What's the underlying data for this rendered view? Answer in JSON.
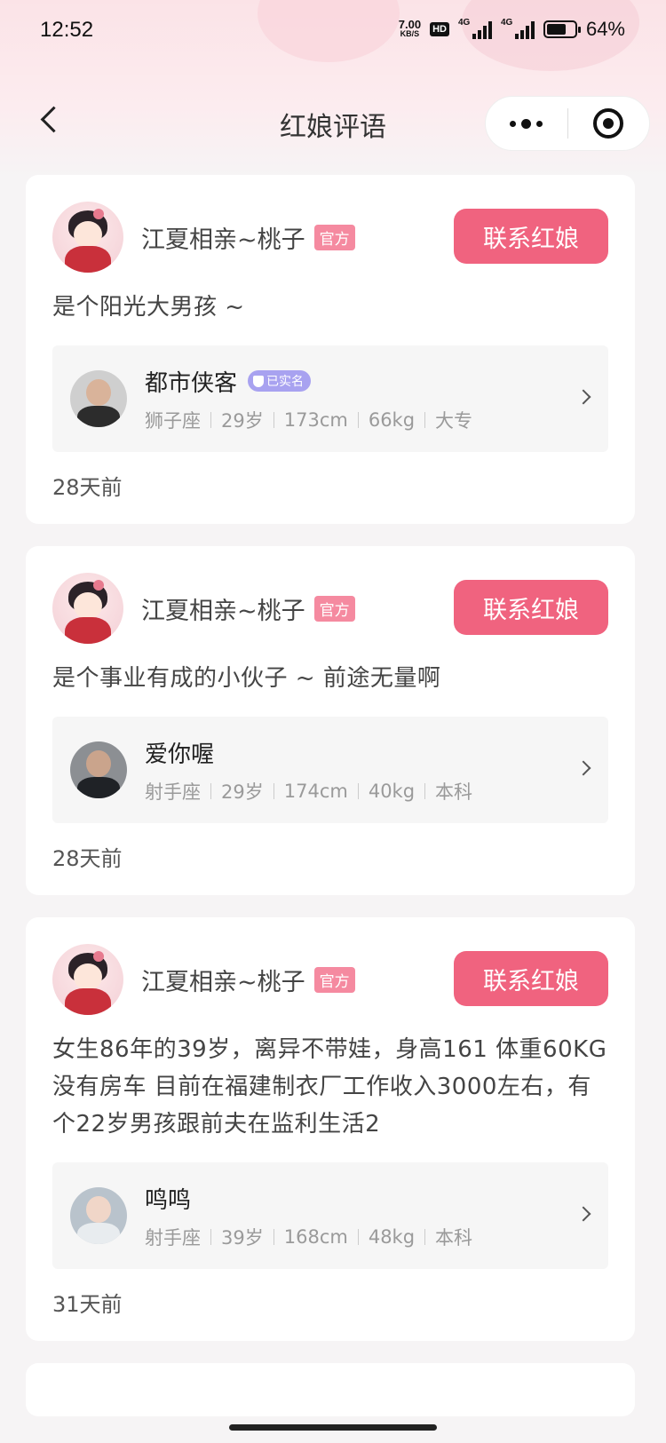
{
  "status_bar": {
    "time": "12:52",
    "speed_value": "7.00",
    "speed_unit": "KB/S",
    "hd": "HD",
    "signal1": "4G",
    "signal2": "4G",
    "battery": "64%"
  },
  "nav": {
    "title": "红娘评语"
  },
  "cards": [
    {
      "matchmaker_name": "江夏相亲~桃子",
      "matchmaker_tag": "官方",
      "contact_label": "联系红娘",
      "comment": "是个阳光大男孩 ~",
      "user": {
        "name": "都市侠客",
        "verified": "已实名",
        "zodiac": "狮子座",
        "age": "29岁",
        "height": "173cm",
        "weight": "66kg",
        "education": "大专"
      },
      "time_ago": "28天前"
    },
    {
      "matchmaker_name": "江夏相亲~桃子",
      "matchmaker_tag": "官方",
      "contact_label": "联系红娘",
      "comment": "是个事业有成的小伙子 ~ 前途无量啊",
      "user": {
        "name": "爱你喔",
        "verified": "",
        "zodiac": "射手座",
        "age": "29岁",
        "height": "174cm",
        "weight": "40kg",
        "education": "本科"
      },
      "time_ago": "28天前"
    },
    {
      "matchmaker_name": "江夏相亲~桃子",
      "matchmaker_tag": "官方",
      "contact_label": "联系红娘",
      "comment": "女生86年的39岁，离异不带娃，身高161 体重60KG 没有房车 目前在福建制衣厂工作收入3000左右，有个22岁男孩跟前夫在监利生活2",
      "user": {
        "name": "鸣鸣",
        "verified": "",
        "zodiac": "射手座",
        "age": "39岁",
        "height": "168cm",
        "weight": "48kg",
        "education": "本科"
      },
      "time_ago": "31天前"
    }
  ],
  "colors": {
    "accent": "#f0637f",
    "tag": "#f58aa0",
    "verified": "#a8a2f0"
  },
  "icons": [
    "back-arrow-icon",
    "more-dots-icon",
    "close-target-icon",
    "chevron-right-icon",
    "shield-icon"
  ]
}
